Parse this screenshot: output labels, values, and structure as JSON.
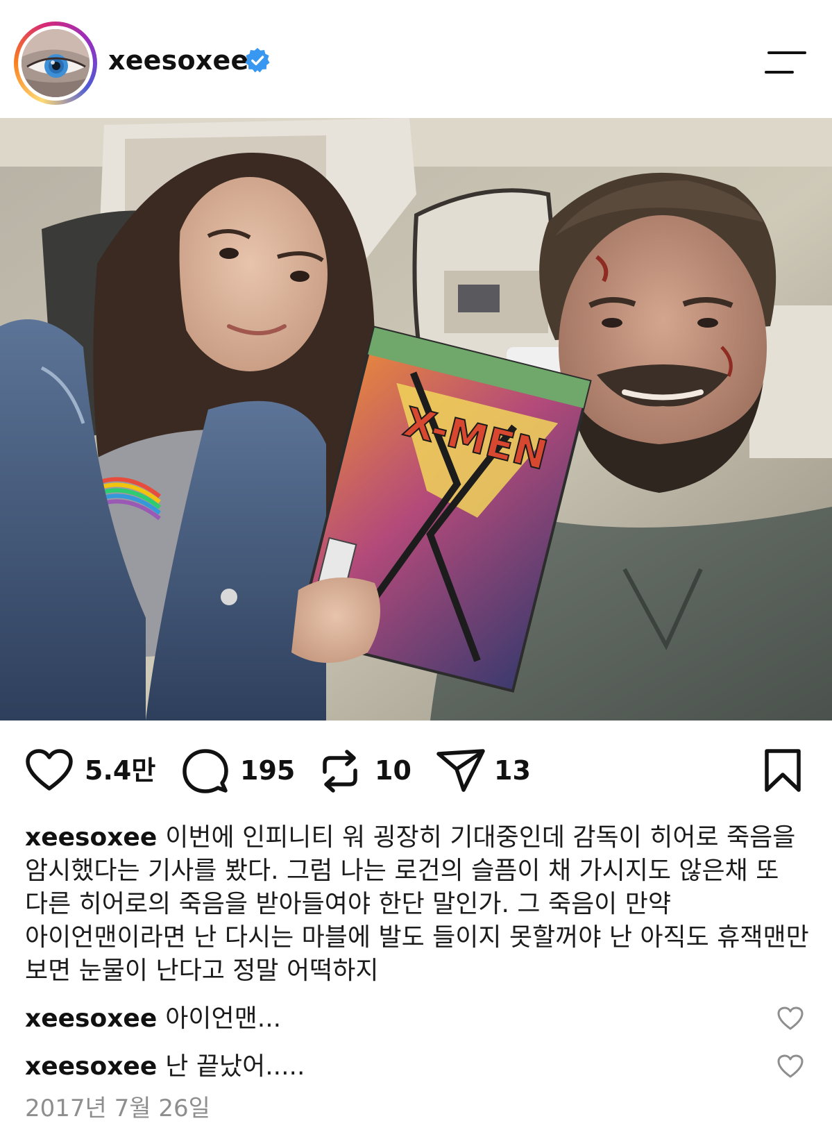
{
  "header": {
    "username": "xeesoxee",
    "verified_icon": "verified-badge-icon",
    "menu_icon": "menu-icon"
  },
  "photo": {
    "comic_title": "X-MEN"
  },
  "actions": {
    "likes": "5.4만",
    "comments": "195",
    "reposts": "10",
    "shares": "13"
  },
  "caption": {
    "username": "xeesoxee",
    "text": "이번에 인피니티 워 굉장히 기대중인데 감독이 히어로 죽음을 암시했다는 기사를 봤다. 그럼 나는 로건의 슬픔이 채 가시지도 않은채 또 다른 히어로의 죽음을 받아들여야 한단 말인가. 그 죽음이 만약 아이언맨이라면 난 다시는 마블에 발도 들이지 못할꺼야 난 아직도 휴잭맨만 보면 눈물이 난다고 정말 어떡하지"
  },
  "comments": [
    {
      "username": "xeesoxee",
      "text": "아이언맨..."
    },
    {
      "username": "xeesoxee",
      "text": "난 끝났어....."
    }
  ],
  "date": "2017년 7월 26일",
  "colors": {
    "verified": "#3897f0",
    "date_text": "#8e8e8e",
    "text": "#111111"
  }
}
